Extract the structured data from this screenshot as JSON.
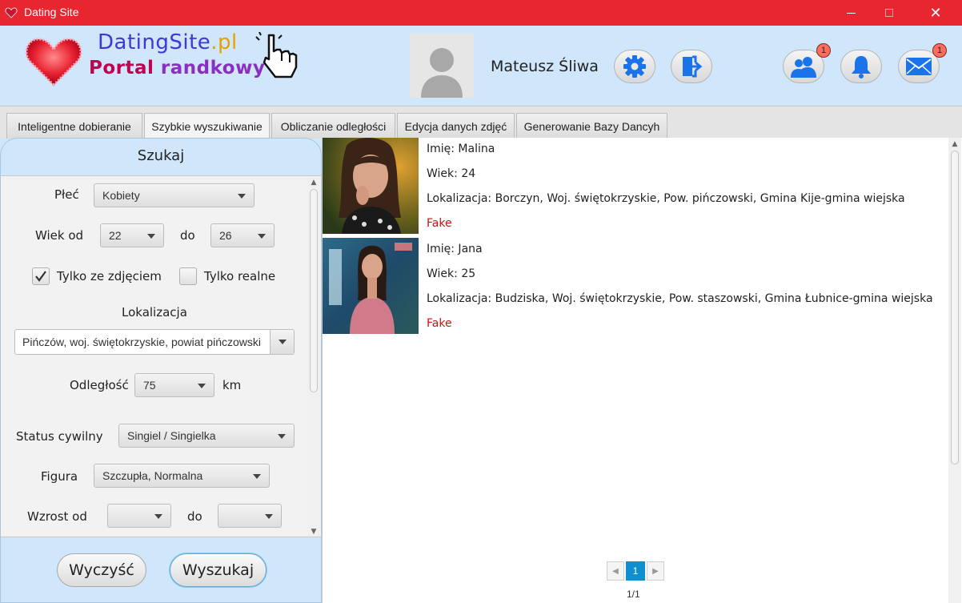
{
  "window": {
    "title": "Dating Site"
  },
  "header": {
    "logo_main": "DatingSite",
    "logo_tld": ".pl",
    "logo_sub1": "Portal ",
    "logo_sub2": "randkowy",
    "user_name": "Mateusz Śliwa",
    "friends_badge": "1",
    "messages_badge": "1",
    "icons": [
      "settings-icon",
      "logout-icon",
      "friends-icon",
      "bell-icon",
      "mail-icon"
    ],
    "accent": "#1a73e8"
  },
  "tabs": [
    {
      "label": "Inteligentne dobieranie"
    },
    {
      "label": "Szybkie wyszukiwanie"
    },
    {
      "label": "Obliczanie odległości"
    },
    {
      "label": "Edycja danych zdjęć"
    },
    {
      "label": "Generowanie Bazy Dancyh"
    }
  ],
  "search": {
    "title": "Szukaj",
    "gender_label": "Płeć",
    "gender_value": "Kobiety",
    "age_from_label": "Wiek od",
    "age_from_value": "22",
    "age_to_label": "do",
    "age_to_value": "26",
    "photo_only_label": "Tylko ze zdjęciem",
    "photo_only_checked": true,
    "real_only_label": "Tylko realne",
    "real_only_checked": false,
    "location_label": "Lokalizacja",
    "location_value": "Pińczów, woj. świętokrzyskie, powiat pińczowski",
    "distance_label": "Odległość",
    "distance_value": "75",
    "distance_unit": "km",
    "marital_label": "Status cywilny",
    "marital_value": "Singiel / Singielka",
    "figure_label": "Figura",
    "figure_value": "Szczupła, Normalna",
    "height_from_label": "Wzrost od",
    "height_to_label": "do",
    "clear_button": "Wyczyść",
    "search_button": "Wyszukaj"
  },
  "results": [
    {
      "name": "Imię: Malina",
      "age": "Wiek: 24",
      "location": "Lokalizacja: Borczyn, Woj. świętokrzyskie, Pow. pińczowski, Gmina Kije-gmina wiejska",
      "status": "Fake"
    },
    {
      "name": "Imię: Jana",
      "age": "Wiek: 25",
      "location": "Lokalizacja: Budziska, Woj. świętokrzyskie, Pow. staszowski, Gmina Łubnice-gmina wiejska",
      "status": "Fake"
    }
  ],
  "pagination": {
    "current": "1",
    "info": "1/1"
  }
}
